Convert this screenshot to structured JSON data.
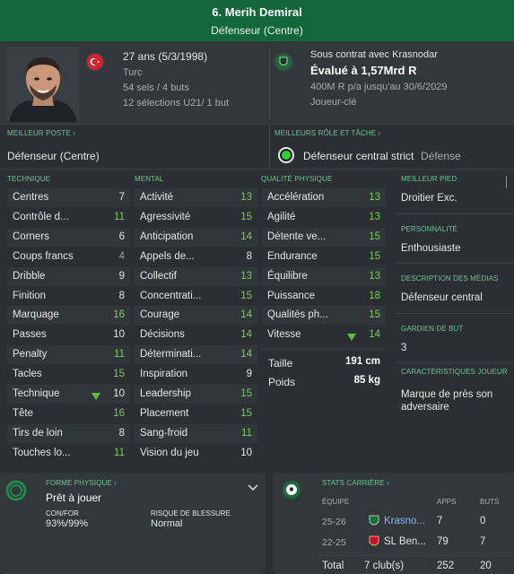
{
  "header": {
    "title": "6. Merih Demiral",
    "position": "Défenseur (Centre)"
  },
  "bio": {
    "age_dob": "27 ans (5/3/1998)",
    "nationality": "Turc",
    "caps": "54 sels / 4 buts",
    "u21_caps": "12 sélections U21/ 1 but"
  },
  "contract": {
    "title": "Sous contrat avec Krasnodar",
    "value": "Évalué à 1,57Mrd R",
    "wage": "400M R p/a jusqu'au 30/6/2029",
    "role": "Joueur-clé"
  },
  "best_position": {
    "header": "MEILLEUR POSTE",
    "value": "Défenseur (Centre)"
  },
  "best_role": {
    "header": "MEILLEURS RÔLE ET TÂCHE",
    "role": "Défenseur central strict",
    "duty": "Défense",
    "indicator_color": "#2ed12e"
  },
  "technical": {
    "header": "TECHNIQUE",
    "rows": [
      {
        "label": "Centres",
        "value": "7"
      },
      {
        "label": "Contrôle d...",
        "value": "11"
      },
      {
        "label": "Corners",
        "value": "6"
      },
      {
        "label": "Coups francs",
        "value": "4"
      },
      {
        "label": "Dribble",
        "value": "9"
      },
      {
        "label": "Finition",
        "value": "8"
      },
      {
        "label": "Marquage",
        "value": "16"
      },
      {
        "label": "Passes",
        "value": "10"
      },
      {
        "label": "Penalty",
        "value": "11"
      },
      {
        "label": "Tacles",
        "value": "15"
      },
      {
        "label": "Technique",
        "value": "10"
      },
      {
        "label": "Tête",
        "value": "16"
      },
      {
        "label": "Tirs de loin",
        "value": "8"
      },
      {
        "label": "Touches lo...",
        "value": "11"
      }
    ]
  },
  "mental": {
    "header": "MENTAL",
    "rows": [
      {
        "label": "Activité",
        "value": "13"
      },
      {
        "label": "Agressivité",
        "value": "15"
      },
      {
        "label": "Anticipation",
        "value": "14"
      },
      {
        "label": "Appels de...",
        "value": "8"
      },
      {
        "label": "Collectif",
        "value": "13"
      },
      {
        "label": "Concentrati...",
        "value": "15"
      },
      {
        "label": "Courage",
        "value": "14"
      },
      {
        "label": "Décisions",
        "value": "14"
      },
      {
        "label": "Déterminati...",
        "value": "14"
      },
      {
        "label": "Inspiration",
        "value": "9"
      },
      {
        "label": "Leadership",
        "value": "15"
      },
      {
        "label": "Placement",
        "value": "15"
      },
      {
        "label": "Sang-froid",
        "value": "11"
      },
      {
        "label": "Vision du jeu",
        "value": "10"
      }
    ]
  },
  "physical": {
    "header": "QUALITÉ PHYSIQUE",
    "rows": [
      {
        "label": "Accélération",
        "value": "13"
      },
      {
        "label": "Agilité",
        "value": "13"
      },
      {
        "label": "Détente ve...",
        "value": "15"
      },
      {
        "label": "Endurance",
        "value": "15"
      },
      {
        "label": "Équilibre",
        "value": "13"
      },
      {
        "label": "Puissance",
        "value": "18"
      },
      {
        "label": "Qualités ph...",
        "value": "15"
      },
      {
        "label": "Vitesse",
        "value": "14"
      }
    ],
    "height_label": "Taille",
    "height_value": "191 cm",
    "weight_label": "Poids",
    "weight_value": "85 kg"
  },
  "side": {
    "foot_header": "MEILLEUR PIED",
    "foot_value": "Droitier Exc.",
    "personality_header": "PERSONNALITÉ",
    "personality_value": "Enthousiaste",
    "media_header": "DESCRIPTION DES MÉDIAS",
    "media_value": "Défenseur central",
    "gk_header": "GARDIEN DE BUT",
    "gk_value": "3",
    "traits_header": "CARACTÉRISTIQUES JOUEUR",
    "traits_value": "Marque de près son adversaire"
  },
  "fitness": {
    "header": "FORME PHYSIQUE",
    "status": "Prêt à jouer",
    "con_header": "CON/FOR",
    "con_value": "93%/99%",
    "injury_header": "RISQUE DE BLESSURE",
    "injury_value": "Normal"
  },
  "career": {
    "header": "STATS CARRIÈRE",
    "col_team": "ÉQUIPE",
    "col_apps": "APPS",
    "col_goals": "BUTS",
    "rows": [
      {
        "season": "25-26",
        "team": "Krasno...",
        "apps": "7",
        "goals": "0"
      },
      {
        "season": "22-25",
        "team": "SL Ben...",
        "apps": "79",
        "goals": "7"
      }
    ],
    "total_label": "Total",
    "total_clubs": "7 club(s)",
    "total_apps": "252",
    "total_goals": "20"
  }
}
